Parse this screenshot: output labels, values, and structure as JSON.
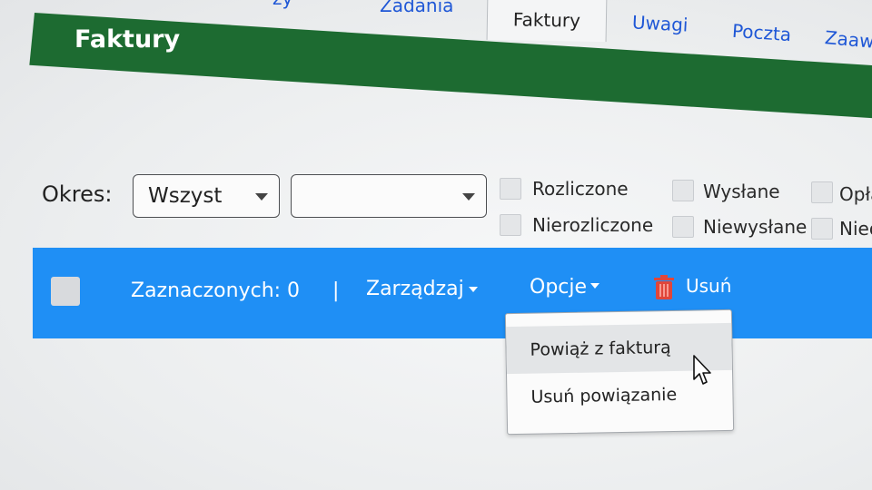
{
  "tabs": {
    "partial": "zy",
    "zadania": "Zadania",
    "faktury": "Faktury",
    "uwagi": "Uwagi",
    "poczta": "Poczta",
    "zaawansowane": "Zaawa"
  },
  "header": {
    "title": "Faktury",
    "color": "#1d6b31"
  },
  "filters": {
    "period_label": "Okres:",
    "period_value": "Wszyst",
    "second_value": "",
    "checkboxes": [
      {
        "label": "Rozliczone",
        "checked": false
      },
      {
        "label": "Nierozliczone",
        "checked": false
      },
      {
        "label": "Wysłane",
        "checked": false
      },
      {
        "label": "Niewysłane",
        "checked": false
      },
      {
        "label": "Opła",
        "checked": false
      },
      {
        "label": "Nieo",
        "checked": false
      }
    ]
  },
  "toolbar": {
    "color": "#1f8ff5",
    "selected_label": "Zaznaczonych: 0",
    "separator": "|",
    "manage": "Zarządzaj",
    "options": "Opcje",
    "delete": "Usuń",
    "delete_icon": "trash-icon"
  },
  "options_menu": {
    "items": [
      {
        "label": "Powiąż z fakturą",
        "highlighted": true
      },
      {
        "label": "Usuń powiązanie",
        "highlighted": false
      }
    ]
  }
}
